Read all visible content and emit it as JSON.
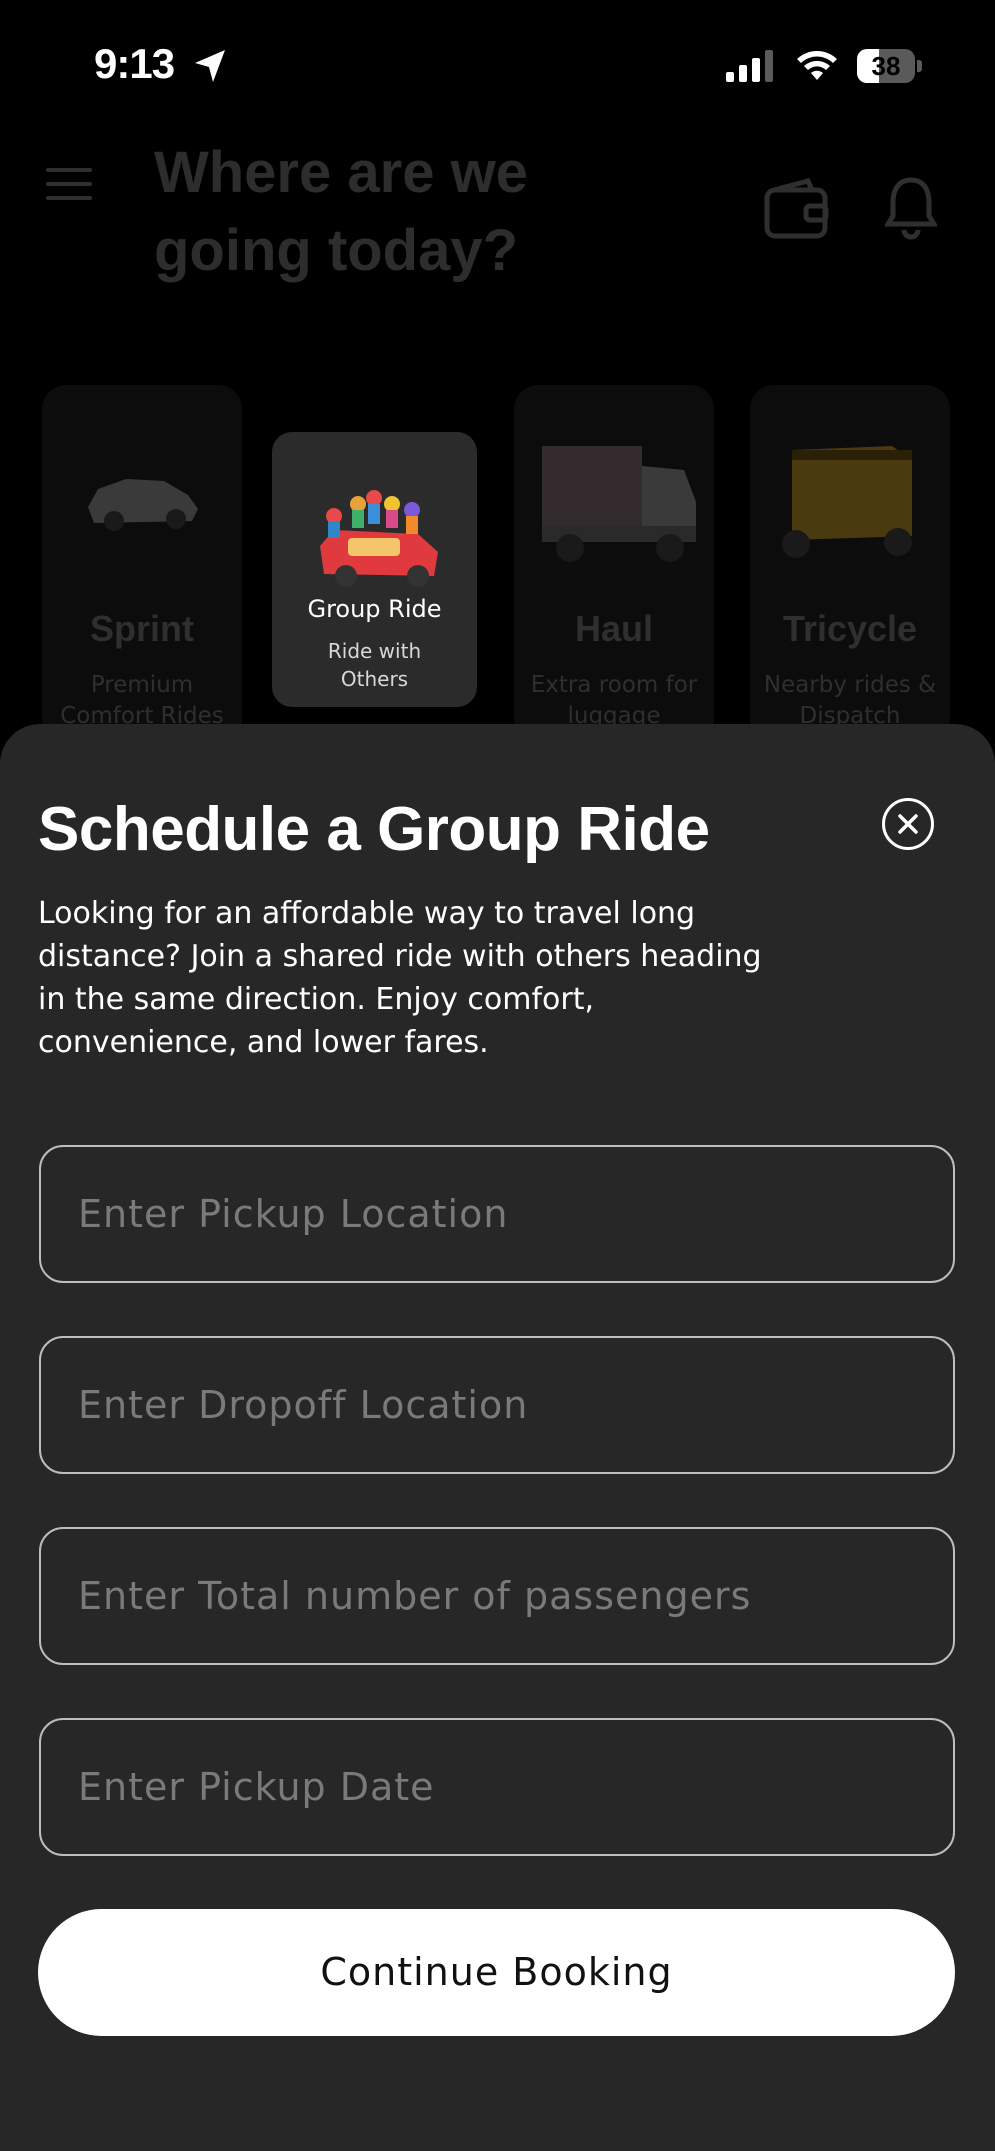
{
  "status_bar": {
    "time": "9:13",
    "battery": "38",
    "battery_level": 0.38
  },
  "home": {
    "heading": "Where are we going today?",
    "categories": [
      {
        "title": "Sprint",
        "subtitle": "Premium Comfort Rides",
        "icon": "car-icon"
      },
      {
        "title": "Group Ride",
        "subtitle": "Ride with Others",
        "icon": "group-car-icon"
      },
      {
        "title": "Haul",
        "subtitle": "Extra room for luggage",
        "icon": "truck-icon"
      },
      {
        "title": "Tricycle",
        "subtitle": "Nearby rides & Dispatch",
        "icon": "tricycle-icon"
      }
    ]
  },
  "sheet": {
    "title": "Schedule a Group Ride",
    "description": "Looking for an affordable way to travel long distance? Join a shared ride with others heading in the same direction. Enjoy comfort, convenience, and lower fares.",
    "fields": [
      {
        "placeholder": "Enter Pickup Location"
      },
      {
        "placeholder": "Enter Dropoff Location"
      },
      {
        "placeholder": "Enter Total number of passengers"
      },
      {
        "placeholder": "Enter Pickup Date"
      }
    ],
    "continue_label": "Continue Booking"
  },
  "colors": {
    "sheet_bg": "#272727",
    "backdrop": "#000000",
    "button_bg": "#ffffff"
  }
}
